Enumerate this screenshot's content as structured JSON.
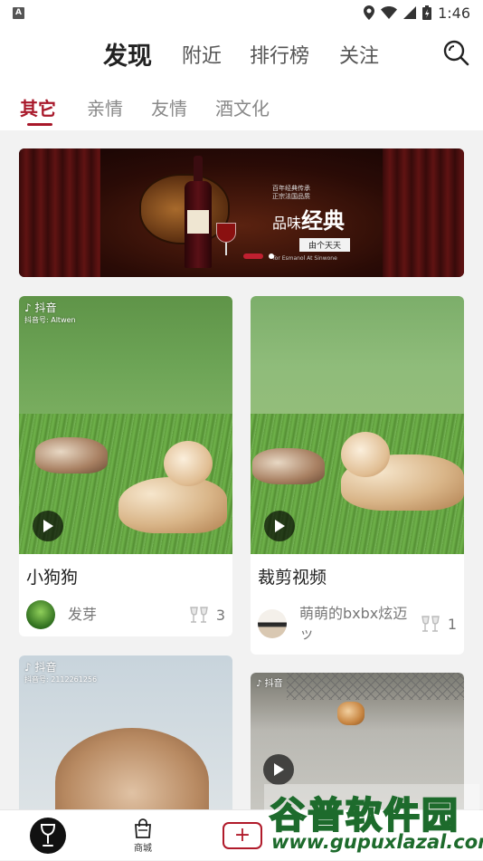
{
  "status_bar": {
    "badge": "A",
    "time": "1:46"
  },
  "top_nav": {
    "tabs": [
      {
        "label": "发现",
        "active": true
      },
      {
        "label": "附近",
        "active": false
      },
      {
        "label": "排行榜",
        "active": false
      },
      {
        "label": "关注",
        "active": false
      }
    ],
    "search_icon": "search-icon"
  },
  "sub_nav": {
    "tabs": [
      {
        "label": "其它",
        "active": true
      },
      {
        "label": "亲情",
        "active": false
      },
      {
        "label": "友情",
        "active": false
      },
      {
        "label": "酒文化",
        "active": false
      }
    ],
    "accent": "#a8182a"
  },
  "banner": {
    "small_lines": [
      "百年经典传承",
      "正宗法国品质"
    ],
    "headline_prefix": "品味",
    "headline_main": "经典",
    "script_line": "由个天天",
    "footer": "Tor Esmanol At Sinwone",
    "dots": [
      true,
      false
    ]
  },
  "feed": {
    "cards": [
      {
        "title": "小狗狗",
        "platform": "抖音",
        "platform_id": "抖音号: Altwen",
        "author": "发芽",
        "likes": "3"
      },
      {
        "title": "裁剪视频",
        "author": "萌萌的bxbx炫迈ッ",
        "likes": "1"
      },
      {
        "platform": "抖音",
        "platform_id": "抖音号: 2112261256"
      },
      {
        "platform": "抖音"
      }
    ]
  },
  "bottom_bar": {
    "items": [
      {
        "icon": "wine-glass-icon",
        "label": ""
      },
      {
        "icon": "shopping-bag-icon",
        "label": "商城"
      },
      {
        "icon": "plus-icon",
        "label": "+"
      }
    ]
  },
  "watermark": {
    "line1": "谷普软件园",
    "line2": "www.gupuxlazal.com"
  }
}
